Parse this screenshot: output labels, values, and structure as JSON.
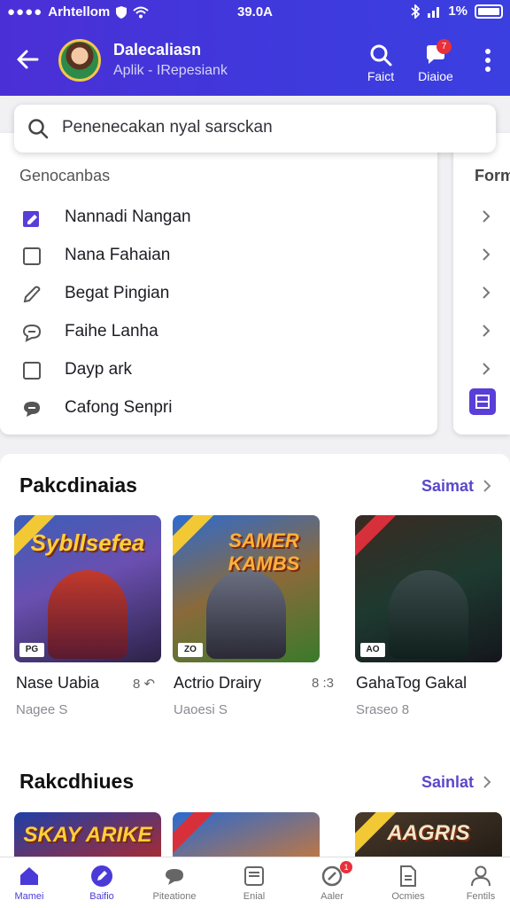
{
  "status_bar": {
    "carrier": "Arhtellom",
    "time": "39.0A",
    "battery": "1%"
  },
  "header": {
    "title": "Dalecaliasn",
    "subtitle": "Aplik - IRepesiank",
    "search_label": "Faict",
    "chat_label": "Diaioe",
    "chat_badge": "7"
  },
  "search": {
    "placeholder": "Penenecakan nyal sarsckan"
  },
  "menu": {
    "section": "Genocanbas",
    "items": [
      {
        "label": "Nannadi Nangan",
        "icon": "edit-doc-icon"
      },
      {
        "label": "Nana Fahaian",
        "icon": "square-icon"
      },
      {
        "label": "Begat Pingian",
        "icon": "pencil-icon"
      },
      {
        "label": "Faihe Lanha",
        "icon": "chat-icon"
      },
      {
        "label": "Dayp ark",
        "icon": "square-icon"
      },
      {
        "label": "Cafong Senpri",
        "icon": "chat-icon"
      }
    ]
  },
  "side_menu": {
    "section": "Formi"
  },
  "shelf1": {
    "title": "Pakcdinaias",
    "see_all": "Saimat",
    "games": [
      {
        "name": "Nase Uabia",
        "meta": "Nagee S",
        "side": "8 ↶",
        "logo": "Sybllsefea",
        "badge": "PG"
      },
      {
        "name": "Actrio Drairy",
        "meta": "Uaoesi S",
        "side": "8 :3",
        "logo": "SAMER KAMBS",
        "badge": "ZO"
      },
      {
        "name": "GahaTog Gakal",
        "meta": "Sraseo 8",
        "side": "",
        "logo": "",
        "badge": "AO"
      }
    ]
  },
  "shelf2": {
    "title": "Rakcdhiues",
    "see_all": "Sainlat",
    "games": [
      {
        "logo": "SKAY ARIKE"
      },
      {
        "logo": ""
      },
      {
        "logo": "AAGRIS"
      }
    ]
  },
  "navbar": {
    "items": [
      {
        "label": "Mamei"
      },
      {
        "label": "Baifio"
      },
      {
        "label": "Piteatione"
      },
      {
        "label": "Enial"
      },
      {
        "label": "Aaler",
        "badge": "1"
      },
      {
        "label": "Ocmies"
      },
      {
        "label": "Fentils"
      }
    ]
  },
  "colors": {
    "header": "#4b2fd6",
    "accent": "#4a3ad8",
    "badge": "#e8303a"
  }
}
